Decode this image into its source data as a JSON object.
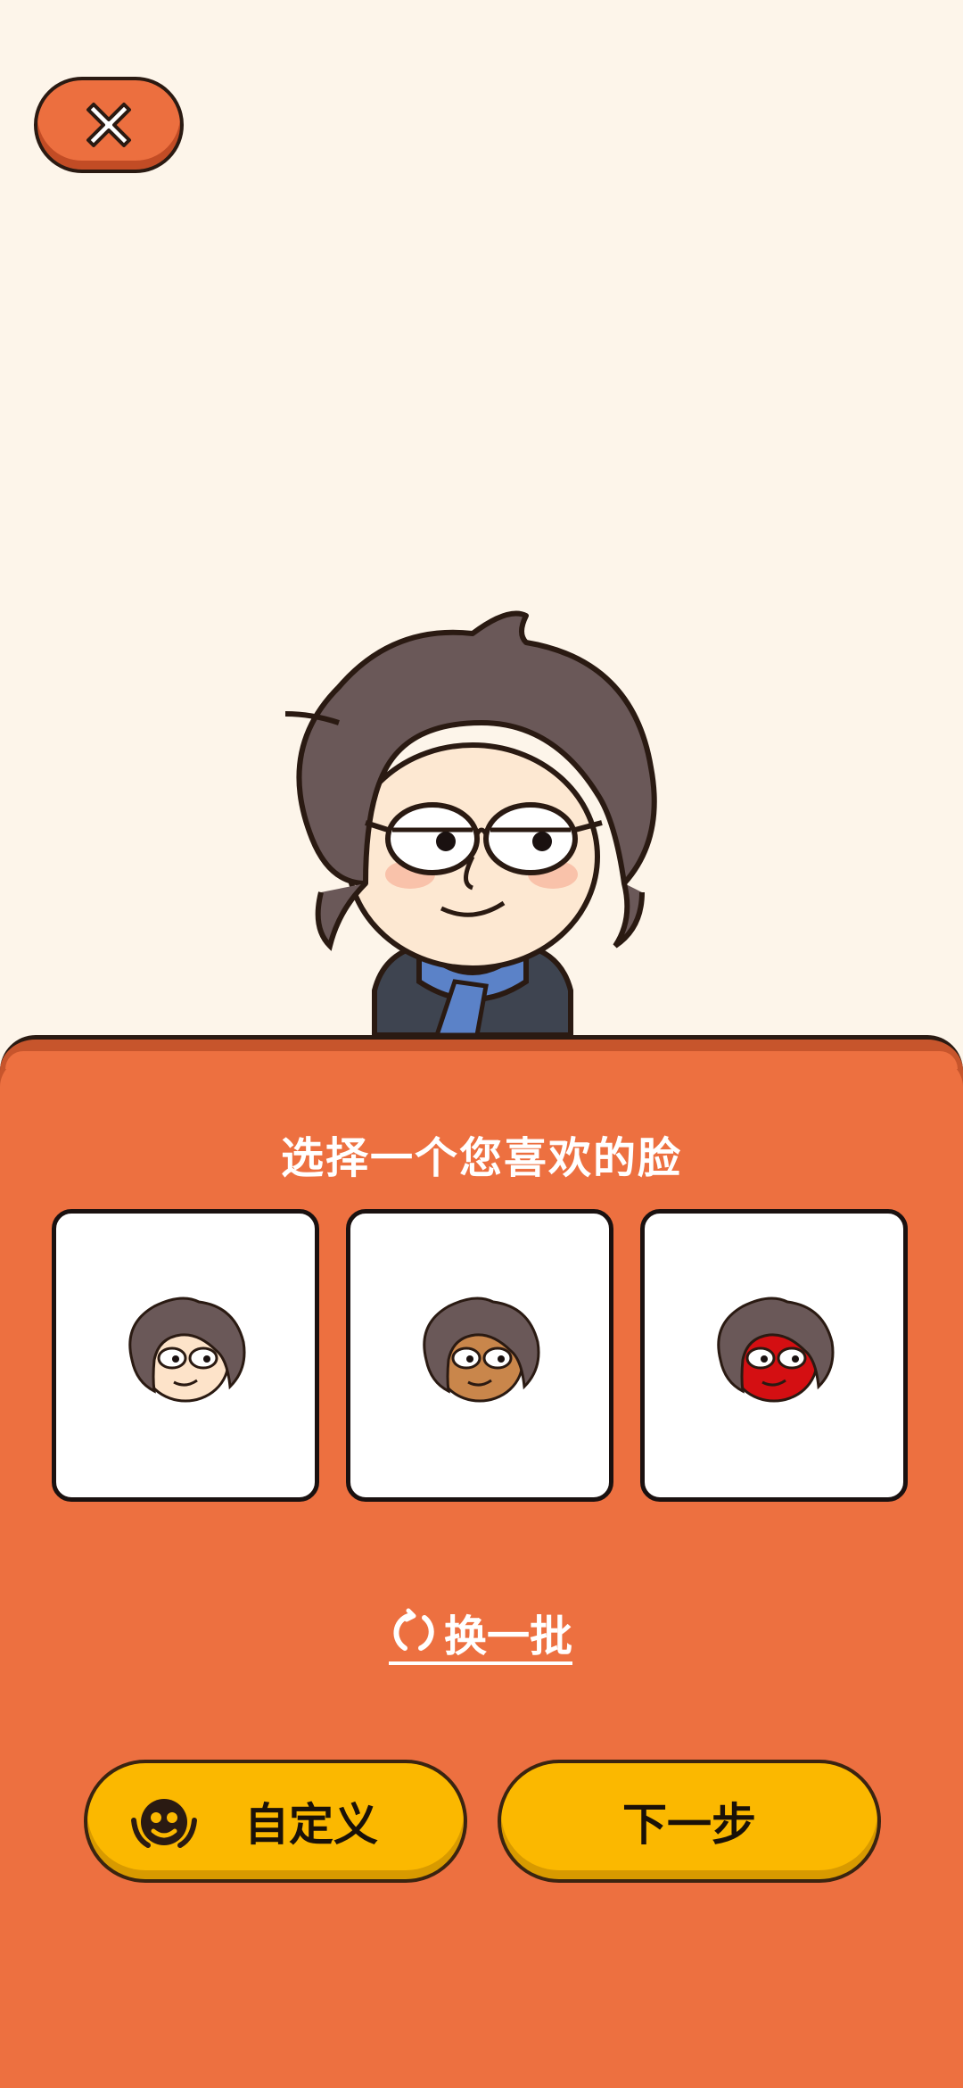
{
  "header": {
    "close_icon": "close-icon"
  },
  "panel": {
    "title": "选择一个您喜欢的脸",
    "faces": [
      {
        "skin": "#fde3c9",
        "icon": "face-light-icon"
      },
      {
        "skin": "#c9864b",
        "icon": "face-tan-icon"
      },
      {
        "skin": "#d40f12",
        "icon": "face-red-icon"
      }
    ],
    "refresh_label": "换一批",
    "custom_label": "自定义",
    "next_label": "下一步"
  },
  "colors": {
    "background": "#fdf5ea",
    "panel": "#ed7040",
    "button": "#fbb800"
  }
}
